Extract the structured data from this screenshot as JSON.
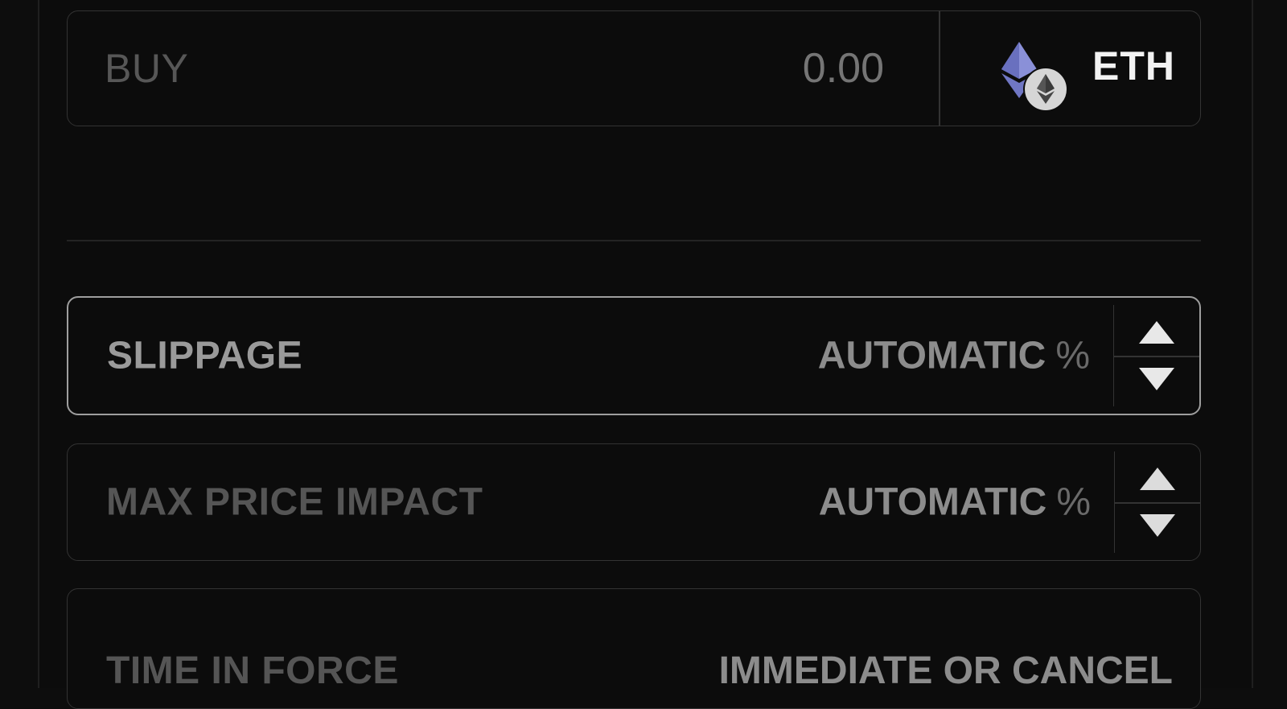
{
  "buy": {
    "label": "BUY",
    "amount_placeholder": "0.00",
    "token": {
      "symbol": "ETH",
      "icon": "ethereum-icon"
    }
  },
  "slippage": {
    "label": "SLIPPAGE",
    "value": "AUTOMATIC",
    "unit": "%"
  },
  "max_price_impact": {
    "label": "MAX PRICE IMPACT",
    "value": "AUTOMATIC",
    "unit": "%"
  },
  "time_in_force": {
    "label": "TIME IN FORCE",
    "value": "IMMEDIATE OR CANCEL"
  },
  "colors": {
    "background": "#0c0c0c",
    "border": "#333333",
    "active_border": "#9e9e9e",
    "muted_text": "#555555",
    "value_text": "#8c8c8c",
    "token_text": "#f2f2f2",
    "eth_purple": "#7b82c9"
  }
}
